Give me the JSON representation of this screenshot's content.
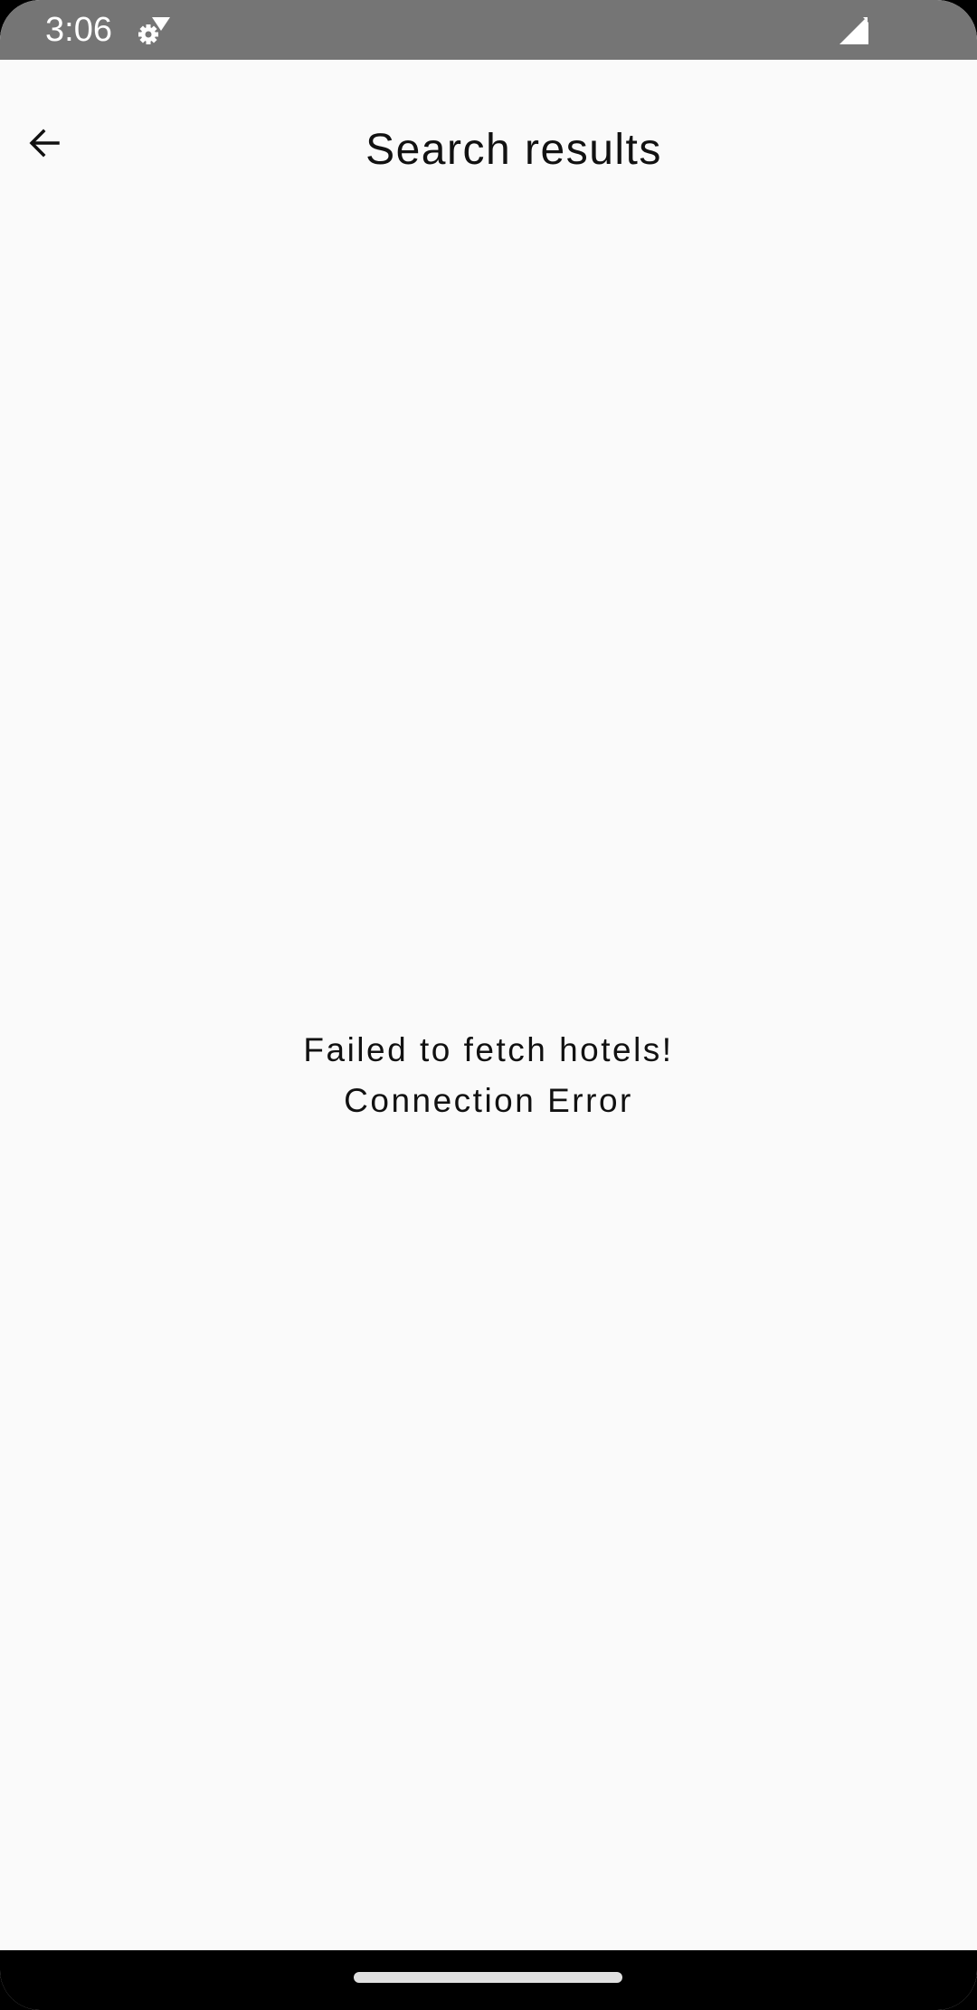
{
  "status_bar": {
    "time": "3:06",
    "icons": [
      "settings-gear-icon",
      "wifi-icon",
      "cell-signal-icon"
    ],
    "background_color": "#757575"
  },
  "app_bar": {
    "back_icon": "arrow-back-icon",
    "title": "Search results"
  },
  "message": {
    "line1": "Failed to fetch hotels!",
    "line2": "Connection Error"
  },
  "nav_bar": {
    "handle": "home-gesture-handle"
  },
  "colors": {
    "page_background": "#fafafa",
    "text": "#111111",
    "nav_background": "#000000"
  }
}
